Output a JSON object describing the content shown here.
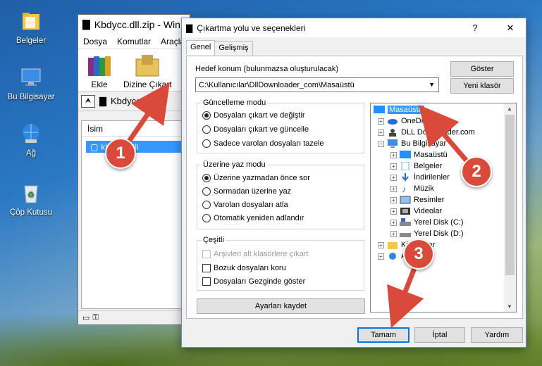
{
  "desktop": {
    "icons": [
      {
        "label": "Belgeler"
      },
      {
        "label": "Bu Bilgisayar"
      },
      {
        "label": "Ağ"
      },
      {
        "label": "Çöp Kutusu"
      }
    ]
  },
  "winrar": {
    "title": "Kbdycc.dll.zip - Win",
    "menu": [
      "Dosya",
      "Komutlar",
      "Araçla"
    ],
    "tools": {
      "add": "Ekle",
      "extract": "Dizine Çıkart"
    },
    "address": "Kbdycc.dll.",
    "list_header": "İsim",
    "file": "kbdycc.dll"
  },
  "dialog": {
    "title": "Çıkartma yolu ve seçenekleri",
    "help_btn": "?",
    "close_btn": "✕",
    "tabs": [
      "Genel",
      "Gelişmiş"
    ],
    "dest_label": "Hedef konum (bulunmazsa oluşturulacak)",
    "dest_value": "C:\\Kullanıcılar\\DllDownloader_com\\Masaüstü",
    "show_btn": "Göster",
    "new_folder_btn": "Yeni klasör",
    "update": {
      "title": "Güncelleme modu",
      "options": [
        "Dosyaları çıkart ve değiştir",
        "Dosyaları çıkart ve güncelle",
        "Sadece varolan dosyaları tazele"
      ],
      "selected": 0
    },
    "overwrite": {
      "title": "Üzerine yaz modu",
      "options": [
        "Üzerine yazmadan önce sor",
        "Sormadan üzerine yaz",
        "Varolan dosyaları atla",
        "Otomatik yeniden adlandır"
      ],
      "selected": 0
    },
    "misc": {
      "title": "Çeşitli",
      "options": [
        "Arşivleri alt klasörlere çıkart",
        "Bozuk dosyaları koru",
        "Dosyaları Gezginde göster"
      ]
    },
    "save_btn": "Ayarları kaydet",
    "tree": [
      "Masaüstü",
      "OneDrive",
      "DLL Downloader.com",
      "Bu Bilgisayar",
      "Masaüstü",
      "Belgeler",
      "İndirilenler",
      "Müzik",
      "Resimler",
      "Videolar",
      "Yerel Disk (C:)",
      "Yerel Disk (D:)",
      "Kitaplıklar",
      "Ağ"
    ],
    "ok_btn": "Tamam",
    "cancel_btn": "İptal",
    "help_text_btn": "Yardım"
  },
  "annotations": [
    "1",
    "2",
    "3"
  ],
  "colors": {
    "annotation": "#d94a3a",
    "selection": "#3399ff"
  }
}
